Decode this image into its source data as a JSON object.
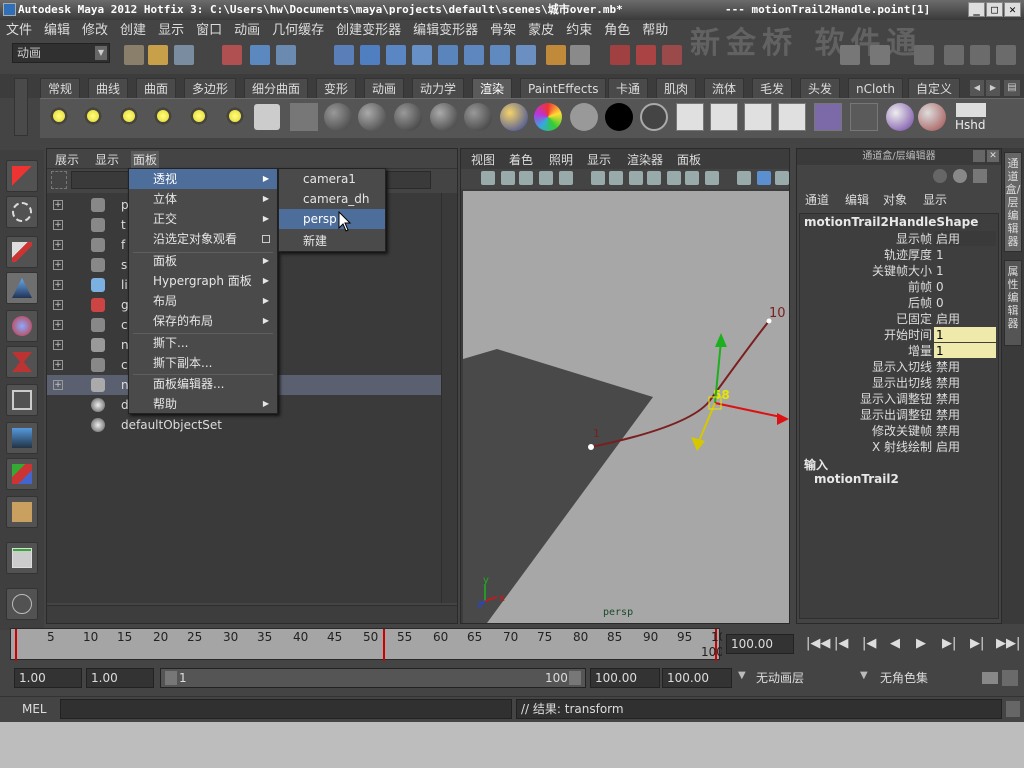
{
  "window": {
    "title": "Autodesk Maya 2012 Hotfix 3: C:\\Users\\hw\\Documents\\maya\\projects\\default\\scenes\\城市over.mb*",
    "title_right": "---   motionTrail2Handle.point[1]"
  },
  "watermark": "新金桥 软件通",
  "menubar": [
    "文件",
    "编辑",
    "修改",
    "创建",
    "显示",
    "窗口",
    "动画",
    "几何缓存",
    "创建变形器",
    "编辑变形器",
    "骨架",
    "蒙皮",
    "约束",
    "角色",
    "帮助"
  ],
  "mode_combo": "动画",
  "shelf_tabs": [
    "常规",
    "曲线",
    "曲面",
    "多边形",
    "细分曲面",
    "变形",
    "动画",
    "动力学",
    "渲染",
    "PaintEffects",
    "卡通",
    "肌肉",
    "流体",
    "毛发",
    "头发",
    "nCloth",
    "自定义"
  ],
  "shelf_active_tab": "渲染",
  "shelf_last_label": "Hshd",
  "outliner": {
    "menu": [
      "展示",
      "显示",
      "面板"
    ],
    "rows": [
      {
        "label": "p"
      },
      {
        "label": "t"
      },
      {
        "label": "f"
      },
      {
        "label": "s"
      },
      {
        "label": "li"
      },
      {
        "label": "g"
      },
      {
        "label": "c"
      },
      {
        "label": "n"
      },
      {
        "label": "c"
      },
      {
        "label": "n"
      },
      {
        "label": "d"
      },
      {
        "label": "defaultObjectSet"
      }
    ]
  },
  "panel_menu": {
    "items": [
      {
        "label": "透视"
      },
      {
        "label": "立体"
      },
      {
        "label": "正交"
      },
      {
        "label": "沿选定对象观看"
      },
      {
        "label": "面板"
      },
      {
        "label": "Hypergraph 面板"
      },
      {
        "label": "布局"
      },
      {
        "label": "保存的布局"
      },
      {
        "label": "撕下..."
      },
      {
        "label": "撕下副本..."
      },
      {
        "label": "面板编辑器..."
      },
      {
        "label": "帮助"
      }
    ],
    "submenu": [
      "camera1",
      "camera_dh",
      "persp",
      "新建"
    ]
  },
  "viewport": {
    "menu": [
      "视图",
      "着色",
      "照明",
      "显示",
      "渲染器",
      "面板"
    ],
    "camera_label": "persp",
    "trail_labels": [
      "10",
      "58",
      "1"
    ],
    "axis": {
      "x": "x",
      "y": "y",
      "z": "z"
    }
  },
  "channel_box": {
    "header": "通道盒/层编辑器",
    "menu": [
      "通道",
      "编辑",
      "对象",
      "显示"
    ],
    "shape": "motionTrail2HandleShape",
    "attrs": [
      {
        "k": "显示帧",
        "v": "启用"
      },
      {
        "k": "轨迹厚度",
        "v": "1"
      },
      {
        "k": "关键帧大小",
        "v": "1"
      },
      {
        "k": "前帧",
        "v": "0"
      },
      {
        "k": "后帧",
        "v": "0"
      },
      {
        "k": "已固定",
        "v": "启用"
      },
      {
        "k": "开始时间",
        "v": "1"
      },
      {
        "k": "增量",
        "v": "1"
      },
      {
        "k": "显示入切线",
        "v": "禁用"
      },
      {
        "k": "显示出切线",
        "v": "禁用"
      },
      {
        "k": "显示入调整钮",
        "v": "禁用"
      },
      {
        "k": "显示出调整钮",
        "v": "禁用"
      },
      {
        "k": "修改关键帧",
        "v": "禁用"
      },
      {
        "k": "X 射线绘制",
        "v": "启用"
      }
    ],
    "inputs_label": "输入",
    "inputs_item": "motionTrail2",
    "side_tabs": [
      "通道盒/层编辑器",
      "属性编辑器"
    ]
  },
  "timeline": {
    "ticks": [
      "5",
      "10",
      "15",
      "20",
      "25",
      "30",
      "35",
      "40",
      "45",
      "50",
      "55",
      "60",
      "65",
      "70",
      "75",
      "80",
      "85",
      "90",
      "95",
      "10"
    ],
    "end_label": "100",
    "current_time": "100.00"
  },
  "range": {
    "start": "1.00",
    "start2": "1.00",
    "slider_start": "1",
    "slider_end": "100",
    "end": "100.00",
    "end2": "100.00",
    "anim_layer": "无动画层",
    "char_set": "无角色集"
  },
  "command": {
    "lang": "MEL",
    "result": "// 结果: transform"
  }
}
